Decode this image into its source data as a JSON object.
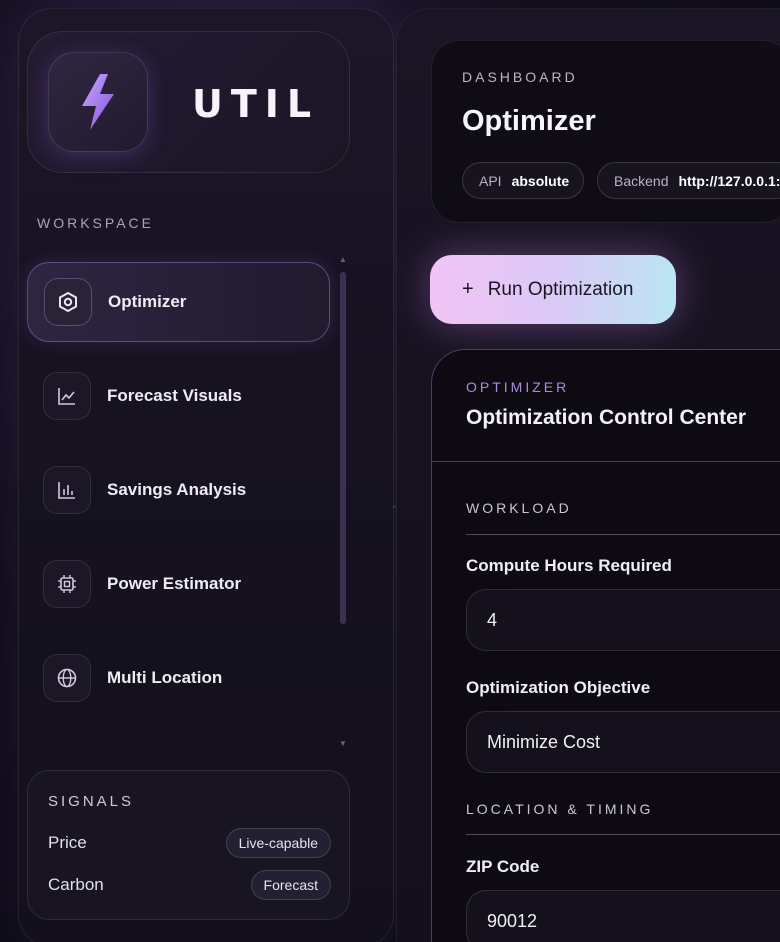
{
  "brand": {
    "name": "UTIL",
    "icon": "lightning-bolt-icon"
  },
  "sidebar": {
    "section_label": "WORKSPACE",
    "items": [
      {
        "label": "Optimizer",
        "icon": "hexagon-icon",
        "active": true
      },
      {
        "label": "Forecast Visuals",
        "icon": "line-chart-icon",
        "active": false
      },
      {
        "label": "Savings Analysis",
        "icon": "bar-chart-icon",
        "active": false
      },
      {
        "label": "Power Estimator",
        "icon": "chip-icon",
        "active": false
      },
      {
        "label": "Multi Location",
        "icon": "globe-icon",
        "active": false
      }
    ],
    "signals": {
      "title": "SIGNALS",
      "rows": [
        {
          "name": "Price",
          "badge": "Live-capable"
        },
        {
          "name": "Carbon",
          "badge": "Forecast"
        }
      ]
    }
  },
  "header": {
    "eyebrow": "DASHBOARD",
    "title": "Optimizer",
    "api": {
      "key": "API",
      "value": "absolute"
    },
    "backend": {
      "key": "Backend",
      "value": "http://127.0.0.1:"
    }
  },
  "actions": {
    "run_label": "Run Optimization",
    "run_icon": "+"
  },
  "optimizer": {
    "eyebrow": "OPTIMIZER",
    "title": "Optimization Control Center",
    "workload": {
      "section": "WORKLOAD",
      "compute_label": "Compute Hours Required",
      "compute_value": "4",
      "objective_label": "Optimization Objective",
      "objective_value": "Minimize Cost"
    },
    "location": {
      "section": "LOCATION & TIMING",
      "zip_label": "ZIP Code",
      "zip_value": "90012"
    }
  },
  "colors": {
    "accent_purple": "#a98be0",
    "button_gradient_start": "#f2c4f5",
    "button_gradient_end": "#b9e6f3",
    "background": "#120e1c"
  }
}
